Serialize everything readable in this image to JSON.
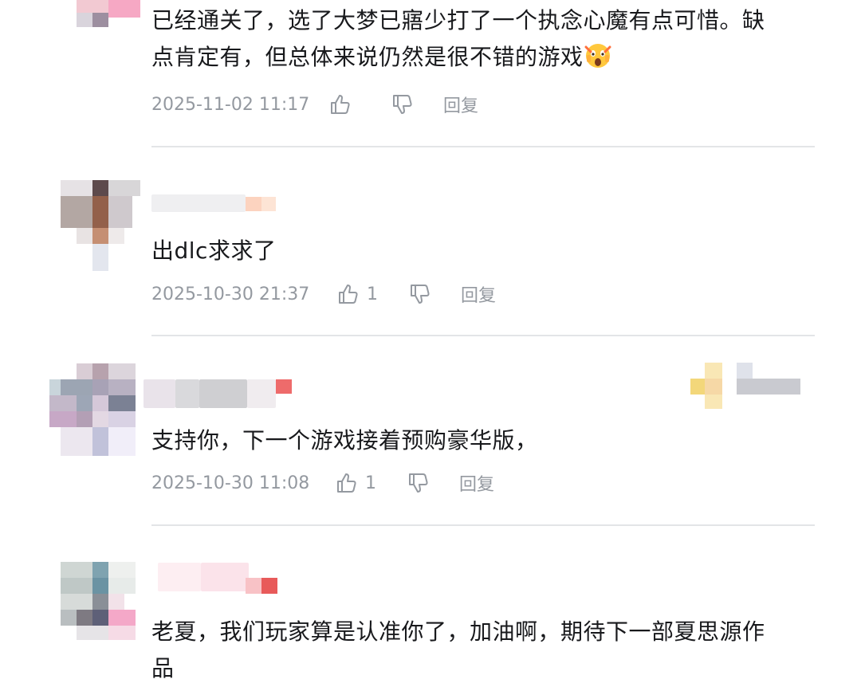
{
  "comments": [
    {
      "text_line1": "已经通关了，选了大梦已寤少打了一个执念心魔有点可惜。缺",
      "text_line2": "点肯定有，但总体来说仍然是很不错的游戏",
      "emoji": "scream-emoji",
      "time": "2025-11-02 11:17",
      "likes": "",
      "reply": "回复"
    },
    {
      "text": "出dlc求求了",
      "time": "2025-10-30 21:37",
      "likes": "1",
      "reply": "回复"
    },
    {
      "text": "支持你，下一个游戏接着预购豪华版，",
      "time": "2025-10-30 11:08",
      "likes": "1",
      "reply": "回复"
    },
    {
      "text_line1": "老夏，我们玩家算是认准你了，加油啊，期待下一部夏思源作",
      "text_line2": "品"
    }
  ],
  "icons": {
    "like": "thumbs-up-icon",
    "dislike": "thumbs-down-icon"
  },
  "colors": {
    "text": "#18191c",
    "meta": "#9499a0",
    "divider": "#e3e5e7"
  }
}
